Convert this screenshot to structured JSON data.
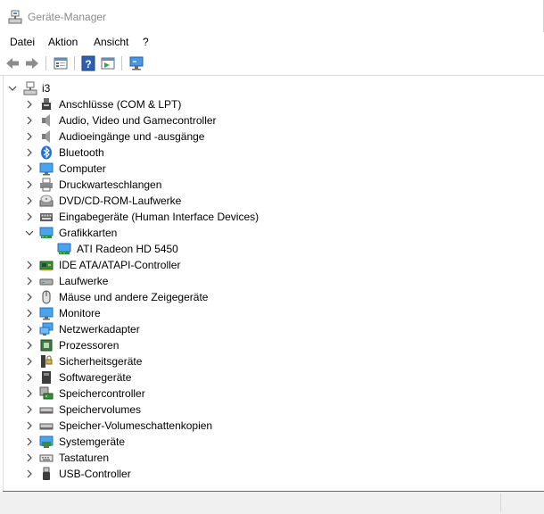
{
  "window": {
    "title": "Geräte-Manager"
  },
  "menu": {
    "items": [
      "Datei",
      "Aktion",
      "Ansicht",
      "?"
    ]
  },
  "tree": {
    "root": "i3",
    "items": [
      {
        "label": "Anschlüsse (COM & LPT)",
        "icon": "port-icon",
        "expanded": false
      },
      {
        "label": "Audio, Video und Gamecontroller",
        "icon": "speaker-icon",
        "expanded": false
      },
      {
        "label": "Audioeingänge und -ausgänge",
        "icon": "speaker-icon",
        "expanded": false
      },
      {
        "label": "Bluetooth",
        "icon": "bluetooth-icon",
        "expanded": false
      },
      {
        "label": "Computer",
        "icon": "monitor-icon",
        "expanded": false
      },
      {
        "label": "Druckwarteschlangen",
        "icon": "printer-icon",
        "expanded": false
      },
      {
        "label": "DVD/CD-ROM-Laufwerke",
        "icon": "disc-drive-icon",
        "expanded": false
      },
      {
        "label": "Eingabegeräte (Human Interface Devices)",
        "icon": "keyboard-device-icon",
        "expanded": false
      },
      {
        "label": "Grafikkarten",
        "icon": "display-adapter-icon",
        "expanded": true,
        "children": [
          {
            "label": "ATI Radeon HD 5450",
            "icon": "display-adapter-icon"
          }
        ]
      },
      {
        "label": "IDE ATA/ATAPI-Controller",
        "icon": "ide-controller-icon",
        "expanded": false
      },
      {
        "label": "Laufwerke",
        "icon": "drive-icon",
        "expanded": false
      },
      {
        "label": "Mäuse und andere Zeigegeräte",
        "icon": "mouse-icon",
        "expanded": false
      },
      {
        "label": "Monitore",
        "icon": "monitor-icon",
        "expanded": false
      },
      {
        "label": "Netzwerkadapter",
        "icon": "network-adapter-icon",
        "expanded": false
      },
      {
        "label": "Prozessoren",
        "icon": "processor-icon",
        "expanded": false
      },
      {
        "label": "Sicherheitsgeräte",
        "icon": "security-device-icon",
        "expanded": false
      },
      {
        "label": "Softwaregeräte",
        "icon": "software-device-icon",
        "expanded": false
      },
      {
        "label": "Speichercontroller",
        "icon": "storage-controller-icon",
        "expanded": false
      },
      {
        "label": "Speichervolumes",
        "icon": "volume-icon",
        "expanded": false
      },
      {
        "label": "Speicher-Volumeschattenkopien",
        "icon": "volume-icon",
        "expanded": false
      },
      {
        "label": "Systemgeräte",
        "icon": "system-device-icon",
        "expanded": false
      },
      {
        "label": "Tastaturen",
        "icon": "keyboard-icon",
        "expanded": false
      },
      {
        "label": "USB-Controller",
        "icon": "usb-icon",
        "expanded": false
      }
    ]
  }
}
